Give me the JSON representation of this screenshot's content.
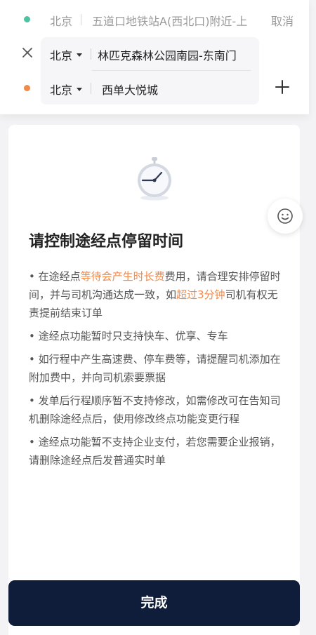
{
  "route": {
    "start": {
      "city": "北京",
      "address": "五道口地铁站A(西北口)附近-上"
    },
    "cancel_label": "取消",
    "via": {
      "city": "北京",
      "address": "林匹克森林公园南园-东南门"
    },
    "destination": {
      "city": "北京",
      "address": "西单大悦城"
    }
  },
  "sheet": {
    "title": "请控制途经点停留时间",
    "rules": [
      {
        "segments": [
          {
            "text": "• 在途经点",
            "hl": false
          },
          {
            "text": "等待会产生时长费",
            "hl": true
          },
          {
            "text": "费用，请合理安排停留时间，并与司机沟通达成一致，如",
            "hl": false
          },
          {
            "text": "超过3分钟",
            "hl": true
          },
          {
            "text": "司机有权无责提前结束订单",
            "hl": false
          }
        ]
      },
      {
        "segments": [
          {
            "text": "• 途经点功能暂时只支持快车、优享、专车",
            "hl": false
          }
        ]
      },
      {
        "segments": [
          {
            "text": "• 如行程中产生高速费、停车费等，请提醒司机添加在附加费中，并向司机索要票据",
            "hl": false
          }
        ]
      },
      {
        "segments": [
          {
            "text": "• 发单后行程顺序暂不支持修改，如需修改可在告知司机删除途经点后，使用修改终点功能变更行程",
            "hl": false
          }
        ]
      },
      {
        "segments": [
          {
            "text": "• 途经点功能暂不支持企业支付，若您需要企业报销，请删除途经点后发普通实时单",
            "hl": false
          }
        ]
      }
    ],
    "done_label": "完成"
  },
  "icons": {
    "clock": "stopwatch-icon",
    "close": "close-icon",
    "add": "plus-icon",
    "feedback": "smiley-icon"
  },
  "colors": {
    "accent": "#f08a4b",
    "start_dot": "#4fc3a1",
    "dest_dot": "#f08a4b",
    "button": "#0f1d3a"
  }
}
